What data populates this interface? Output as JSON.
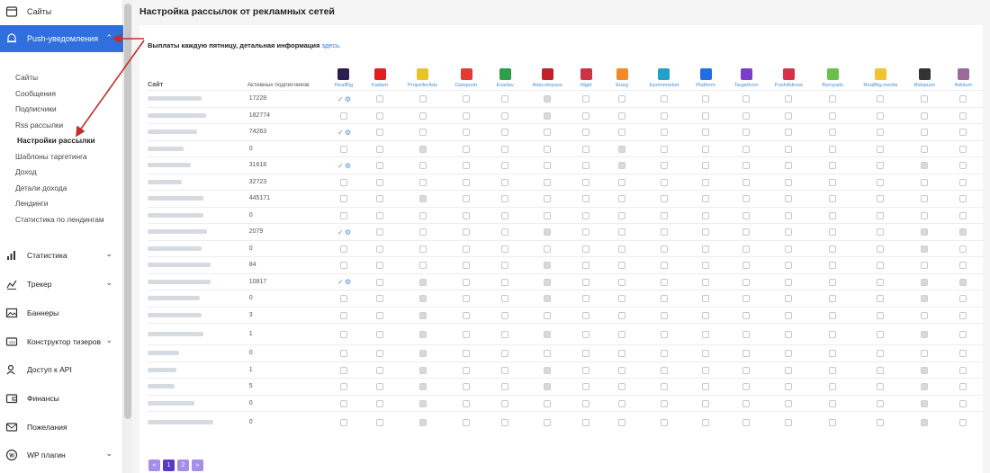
{
  "sidebar": {
    "top_item": "Сайты",
    "active_item": "Push-уведомления",
    "sub_items": [
      "Сайты",
      "Сообщения",
      "Подписчики",
      "Rss рассылки",
      "Настройки рассылки",
      "Шаблоны таргетинга",
      "Доход",
      "Детали дохода",
      "Лендинги",
      "Статистика по лендингам"
    ],
    "sections": [
      {
        "label": "Статистика",
        "icon": "bar-chart-icon",
        "chevron": true
      },
      {
        "label": "Трекер",
        "icon": "tracker-icon",
        "chevron": true
      },
      {
        "label": "Баннеры",
        "icon": "image-icon",
        "chevron": false
      },
      {
        "label": "Конструктор тизеров",
        "icon": "teaser-icon",
        "chevron": true
      },
      {
        "label": "Доступ к API",
        "icon": "user-key-icon",
        "chevron": false
      },
      {
        "label": "Финансы",
        "icon": "wallet-icon",
        "chevron": false
      },
      {
        "label": "Пожелания",
        "icon": "mail-icon",
        "chevron": false
      },
      {
        "label": "WP плагин",
        "icon": "wordpress-icon",
        "chevron": true
      }
    ]
  },
  "page": {
    "title": "Настройка рассылок от рекламных сетей",
    "payinfo_text": "Выплаты каждую пятницу, детальная информация",
    "payinfo_link": "здесь."
  },
  "table": {
    "col_site": "Сайт",
    "col_subs": "Активных подписчиков",
    "networks": [
      {
        "name": "RealBig",
        "color": "#2a1f4f"
      },
      {
        "name": "Kadam",
        "color": "#e02020"
      },
      {
        "name": "PropellerAds",
        "color": "#e8c32a"
      },
      {
        "name": "Datspush",
        "color": "#e53935"
      },
      {
        "name": "Evadav",
        "color": "#2e9e4a"
      },
      {
        "name": "Adscompass",
        "color": "#c0202a"
      },
      {
        "name": "Mgid",
        "color": "#cc3344"
      },
      {
        "name": "Etarg",
        "color": "#f08a2a"
      },
      {
        "name": "Epommarket",
        "color": "#25a0c8"
      },
      {
        "name": "Platform",
        "color": "#1f6fe0"
      },
      {
        "name": "TargetIcon",
        "color": "#7a3ec8"
      },
      {
        "name": "PushAdnow",
        "color": "#d6304a"
      },
      {
        "name": "Bymyads",
        "color": "#6cc04a"
      },
      {
        "name": "RealBig.media",
        "color": "#f2c230"
      },
      {
        "name": "Bidspush",
        "color": "#333333"
      },
      {
        "name": "Adnium",
        "color": "#9a6a9a"
      }
    ],
    "rows": [
      {
        "count": "17228",
        "checked": true,
        "tall": false,
        "gray": [
          5
        ]
      },
      {
        "count": "182774",
        "checked": false,
        "tall": false,
        "gray": [
          5
        ]
      },
      {
        "count": "74263",
        "checked": true,
        "tall": false,
        "gray": []
      },
      {
        "count": "0",
        "checked": false,
        "tall": false,
        "gray": [
          2,
          7
        ]
      },
      {
        "count": "31618",
        "checked": true,
        "tall": false,
        "gray": [
          7,
          14
        ]
      },
      {
        "count": "32723",
        "checked": false,
        "tall": false,
        "gray": []
      },
      {
        "count": "445171",
        "checked": false,
        "tall": false,
        "gray": [
          2
        ]
      },
      {
        "count": "0",
        "checked": false,
        "tall": false,
        "gray": []
      },
      {
        "count": "2079",
        "checked": true,
        "tall": false,
        "gray": [
          5,
          14,
          15
        ]
      },
      {
        "count": "0",
        "checked": false,
        "tall": false,
        "gray": [
          14
        ]
      },
      {
        "count": "84",
        "checked": false,
        "tall": false,
        "gray": [
          5
        ]
      },
      {
        "count": "10817",
        "checked": true,
        "tall": false,
        "gray": [
          2,
          5,
          14,
          15
        ]
      },
      {
        "count": "0",
        "checked": false,
        "tall": false,
        "gray": [
          2,
          5,
          14
        ]
      },
      {
        "count": "3",
        "checked": false,
        "tall": false,
        "gray": [
          2
        ]
      },
      {
        "count": "1",
        "checked": false,
        "tall": true,
        "gray": [
          2,
          5,
          14
        ]
      },
      {
        "count": "0",
        "checked": false,
        "tall": false,
        "gray": [
          2
        ]
      },
      {
        "count": "1",
        "checked": false,
        "tall": false,
        "gray": [
          2,
          5,
          14
        ]
      },
      {
        "count": "5",
        "checked": false,
        "tall": false,
        "gray": [
          2,
          5,
          14
        ]
      },
      {
        "count": "0",
        "checked": false,
        "tall": false,
        "gray": [
          2,
          14
        ]
      },
      {
        "count": "0",
        "checked": false,
        "tall": true,
        "gray": [
          2,
          14
        ]
      }
    ]
  },
  "pager": {
    "prev": "«",
    "pages": [
      "1",
      "2"
    ],
    "next": "»"
  }
}
